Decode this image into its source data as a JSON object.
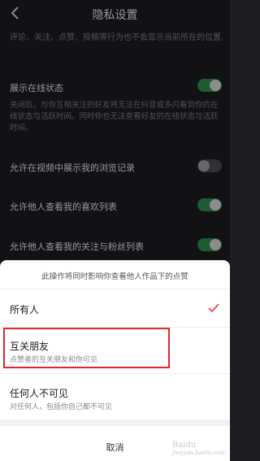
{
  "header": {
    "title": "隐私设置",
    "back_icon": "chevron-left-icon"
  },
  "settings": {
    "top_desc": "评论、关注、点赞、投稿等行为也不会显示当前所在的位置。",
    "rows": [
      {
        "title": "展示在线状态",
        "desc": "关闭后，与你互相关注的好友将无法在抖音或多闪看到你的在线状态与活跃时间。同时你也无法查看好友的在线状态与活跃时间。",
        "toggle": "on"
      },
      {
        "title": "允许在视频中展示我的浏览记录",
        "toggle": "off"
      },
      {
        "title": "允许他人查看我的喜欢列表",
        "toggle": "on"
      },
      {
        "title": "允许他人查看我的关注与粉丝列表",
        "toggle": "on"
      }
    ]
  },
  "sheet": {
    "hint": "此操作将同时影响你查看他人作品下的点赞",
    "options": [
      {
        "title": "所有人",
        "selected": true
      },
      {
        "title": "互关朋友",
        "subtitle": "点赞者的互关朋友和你可见"
      },
      {
        "title": "任何人不可见",
        "subtitle": "对任何人，包括你自己都不可见"
      }
    ],
    "cancel": "取消"
  },
  "colors": {
    "toggle_on": "#2f8a4d",
    "check": "#e84a5f",
    "highlight": "#e3262b"
  },
  "watermark": {
    "main": "Baidu",
    "sub": "jingyan.baidu.com"
  }
}
